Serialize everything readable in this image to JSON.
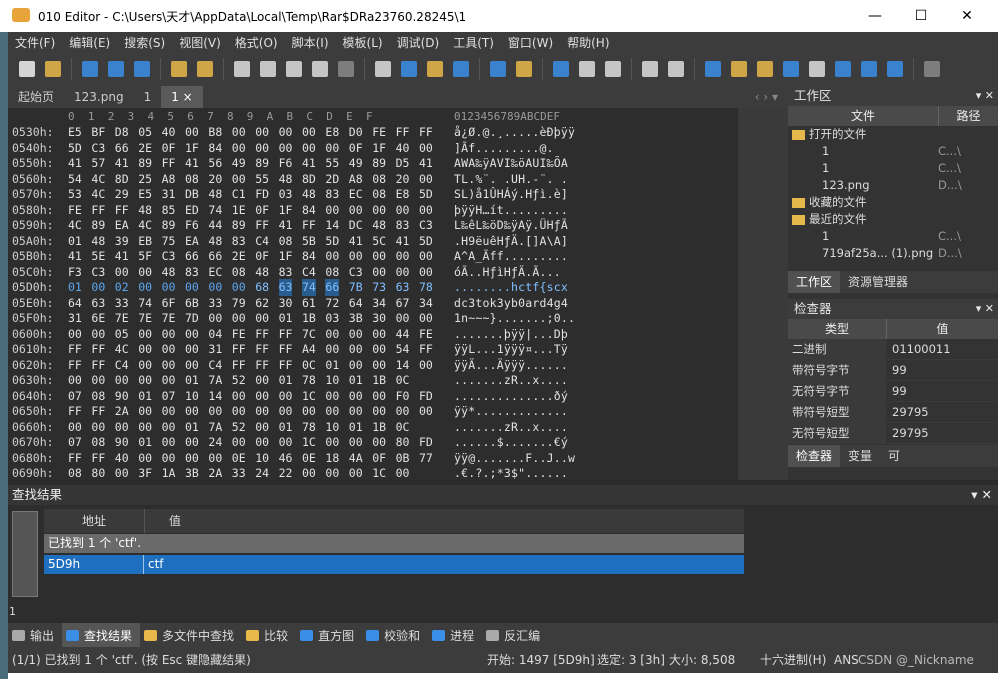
{
  "window": {
    "title": "010 Editor - C:\\Users\\天才\\AppData\\Local\\Temp\\Rar$DRa23760.28245\\1"
  },
  "menu": [
    "文件(F)",
    "编辑(E)",
    "搜索(S)",
    "视图(V)",
    "格式(O)",
    "脚本(I)",
    "模板(L)",
    "调试(D)",
    "工具(T)",
    "窗口(W)",
    "帮助(H)"
  ],
  "tabs": [
    {
      "label": "起始页"
    },
    {
      "label": "123.png"
    },
    {
      "label": "1"
    },
    {
      "label": "1 ×",
      "active": true
    }
  ],
  "hex": {
    "column_header": "0  1  2  3  4  5  6  7  8  9  A  B  C  D  E  F",
    "ascii_header": "0123456789ABCDEF",
    "rows": [
      {
        "addr": "0530h:",
        "bytes": [
          "E5",
          "BF",
          "D8",
          "05",
          "40",
          "00",
          "B8",
          "00",
          "00",
          "00",
          "00",
          "E8",
          "D0",
          "FE",
          "FF",
          "FF"
        ],
        "ascii": "å¿Ø.@.¸.....èÐþÿÿ"
      },
      {
        "addr": "0540h:",
        "bytes": [
          "5D",
          "C3",
          "66",
          "2E",
          "0F",
          "1F",
          "84",
          "00",
          "00",
          "00",
          "00",
          "00",
          "0F",
          "1F",
          "40",
          "00"
        ],
        "ascii": "]Ãf.........@."
      },
      {
        "addr": "0550h:",
        "bytes": [
          "41",
          "57",
          "41",
          "89",
          "FF",
          "41",
          "56",
          "49",
          "89",
          "F6",
          "41",
          "55",
          "49",
          "89",
          "D5",
          "41"
        ],
        "ascii": "AWA‰ÿAVI‰öAUI‰ÕA"
      },
      {
        "addr": "0560h:",
        "bytes": [
          "54",
          "4C",
          "8D",
          "25",
          "A8",
          "08",
          "20",
          "00",
          "55",
          "48",
          "8D",
          "2D",
          "A8",
          "08",
          "20",
          "00"
        ],
        "ascii": "TL.%¨. .UH.-¨. ."
      },
      {
        "addr": "0570h:",
        "bytes": [
          "53",
          "4C",
          "29",
          "E5",
          "31",
          "DB",
          "48",
          "C1",
          "FD",
          "03",
          "48",
          "83",
          "EC",
          "08",
          "E8",
          "5D"
        ],
        "ascii": "SL)å1ÛHÁý.Hƒì.è]"
      },
      {
        "addr": "0580h:",
        "bytes": [
          "FE",
          "FF",
          "FF",
          "48",
          "85",
          "ED",
          "74",
          "1E",
          "0F",
          "1F",
          "84",
          "00",
          "00",
          "00",
          "00",
          "00"
        ],
        "ascii": "þÿÿH…ít........."
      },
      {
        "addr": "0590h:",
        "bytes": [
          "4C",
          "89",
          "EA",
          "4C",
          "89",
          "F6",
          "44",
          "89",
          "FF",
          "41",
          "FF",
          "14",
          "DC",
          "48",
          "83",
          "C3"
        ],
        "ascii": "L‰êL‰öD‰ÿAÿ.ÜHƒÃ"
      },
      {
        "addr": "05A0h:",
        "bytes": [
          "01",
          "48",
          "39",
          "EB",
          "75",
          "EA",
          "48",
          "83",
          "C4",
          "08",
          "5B",
          "5D",
          "41",
          "5C",
          "41",
          "5D"
        ],
        "ascii": ".H9ëuêHƒÄ.[]A\\A]"
      },
      {
        "addr": "05B0h:",
        "bytes": [
          "41",
          "5E",
          "41",
          "5F",
          "C3",
          "66",
          "66",
          "2E",
          "0F",
          "1F",
          "84",
          "00",
          "00",
          "00",
          "00",
          "00"
        ],
        "ascii": "A^A_Ãff........."
      },
      {
        "addr": "05C0h:",
        "bytes": [
          "F3",
          "C3",
          "00",
          "00",
          "48",
          "83",
          "EC",
          "08",
          "48",
          "83",
          "C4",
          "08",
          "C3",
          "00",
          "00",
          "00"
        ],
        "ascii": "óÃ..HƒìHƒÄ.Ã..."
      },
      {
        "addr": "05D0h:",
        "bytes": [
          "01",
          "00",
          "02",
          "00",
          "00",
          "00",
          "00",
          "00",
          "68",
          "63",
          "74",
          "66",
          "7B",
          "73",
          "63",
          "78"
        ],
        "ascii": "........hctf{scx",
        "sel": true
      },
      {
        "addr": "05E0h:",
        "bytes": [
          "64",
          "63",
          "33",
          "74",
          "6F",
          "6B",
          "33",
          "79",
          "62",
          "30",
          "61",
          "72",
          "64",
          "34",
          "67",
          "34"
        ],
        "ascii": "dc3tok3yb0ard4g4"
      },
      {
        "addr": "05F0h:",
        "bytes": [
          "31",
          "6E",
          "7E",
          "7E",
          "7E",
          "7D",
          "00",
          "00",
          "00",
          "01",
          "1B",
          "03",
          "3B",
          "30",
          "00",
          "00"
        ],
        "ascii": "1n~~~}.......;0.."
      },
      {
        "addr": "0600h:",
        "bytes": [
          "00",
          "00",
          "05",
          "00",
          "00",
          "00",
          "04",
          "FE",
          "FF",
          "FF",
          "7C",
          "00",
          "00",
          "00",
          "44",
          "FE"
        ],
        "ascii": ".......þÿÿ|...Dþ"
      },
      {
        "addr": "0610h:",
        "bytes": [
          "FF",
          "FF",
          "4C",
          "00",
          "00",
          "00",
          "31",
          "FF",
          "FF",
          "FF",
          "A4",
          "00",
          "00",
          "00",
          "54",
          "FF"
        ],
        "ascii": "ÿÿL...1ÿÿÿ¤...Tÿ"
      },
      {
        "addr": "0620h:",
        "bytes": [
          "FF",
          "FF",
          "C4",
          "00",
          "00",
          "00",
          "C4",
          "FF",
          "FF",
          "FF",
          "0C",
          "01",
          "00",
          "00",
          "14",
          "00"
        ],
        "ascii": "ÿÿÄ...Äÿÿÿ......"
      },
      {
        "addr": "0630h:",
        "bytes": [
          "00",
          "00",
          "00",
          "00",
          "00",
          "01",
          "7A",
          "52",
          "00",
          "01",
          "78",
          "10",
          "01",
          "1B",
          "0C"
        ],
        "ascii": ".......zR..x...."
      },
      {
        "addr": "0640h:",
        "bytes": [
          "07",
          "08",
          "90",
          "01",
          "07",
          "10",
          "14",
          "00",
          "00",
          "00",
          "1C",
          "00",
          "00",
          "00",
          "F0",
          "FD"
        ],
        "ascii": "..............ðý"
      },
      {
        "addr": "0650h:",
        "bytes": [
          "FF",
          "FF",
          "2A",
          "00",
          "00",
          "00",
          "00",
          "00",
          "00",
          "00",
          "00",
          "00",
          "00",
          "00",
          "00",
          "00"
        ],
        "ascii": "ÿÿ*............."
      },
      {
        "addr": "0660h:",
        "bytes": [
          "00",
          "00",
          "00",
          "00",
          "00",
          "01",
          "7A",
          "52",
          "00",
          "01",
          "78",
          "10",
          "01",
          "1B",
          "0C"
        ],
        "ascii": ".......zR..x...."
      },
      {
        "addr": "0670h:",
        "bytes": [
          "07",
          "08",
          "90",
          "01",
          "00",
          "00",
          "24",
          "00",
          "00",
          "00",
          "1C",
          "00",
          "00",
          "00",
          "80",
          "FD"
        ],
        "ascii": "......$.......€ý"
      },
      {
        "addr": "0680h:",
        "bytes": [
          "FF",
          "FF",
          "40",
          "00",
          "00",
          "00",
          "00",
          "0E",
          "10",
          "46",
          "0E",
          "18",
          "4A",
          "0F",
          "0B",
          "77"
        ],
        "ascii": "ÿÿ@.......F..J..w"
      },
      {
        "addr": "0690h:",
        "bytes": [
          "08",
          "80",
          "00",
          "3F",
          "1A",
          "3B",
          "2A",
          "33",
          "24",
          "22",
          "00",
          "00",
          "00",
          "1C",
          "00"
        ],
        "ascii": ".€.?.;*3$\"......"
      },
      {
        "addr": "06A0h:",
        "bytes": [
          "00",
          "00",
          "44",
          "00",
          "00",
          "00",
          "85",
          "FE",
          "FF",
          "FF",
          "15",
          "00",
          "00",
          "00",
          "00",
          "41"
        ],
        "ascii": "..D....þÿÿ.....A"
      }
    ]
  },
  "workspace": {
    "title": "工作区",
    "col_file": "文件",
    "col_path": "路径",
    "items": [
      {
        "label": "打开的文件",
        "folder": true,
        "path": ""
      },
      {
        "label": "1",
        "path": "C...\\"
      },
      {
        "label": "1",
        "path": "C...\\"
      },
      {
        "label": "123.png",
        "path": "D...\\"
      },
      {
        "label": "收藏的文件",
        "folder": true,
        "path": ""
      },
      {
        "label": "最近的文件",
        "folder": true,
        "path": ""
      },
      {
        "label": "1",
        "path": "C...\\"
      },
      {
        "label": "719af25a... (1).png",
        "path": "D...\\"
      }
    ],
    "tab_workspace": "工作区",
    "tab_explorer": "资源管理器"
  },
  "inspector": {
    "title": "检查器",
    "col_type": "类型",
    "col_value": "值",
    "rows": [
      {
        "type": "二进制",
        "value": "01100011"
      },
      {
        "type": "带符号字节",
        "value": "99"
      },
      {
        "type": "无符号字节",
        "value": "99"
      },
      {
        "type": "带符号短型",
        "value": "29795"
      },
      {
        "type": "无符号短型",
        "value": "29795"
      }
    ],
    "tab_inspector": "检查器",
    "tab_vars": "变量",
    "tab_more": "可"
  },
  "find": {
    "title": "查找结果",
    "col_addr": "地址",
    "col_value": "值",
    "summary": "已找到 1 个 'ctf'.",
    "result_addr": "5D9h",
    "result_value": "ctf",
    "counter": "1"
  },
  "bottom_tabs": [
    "输出",
    "查找结果",
    "多文件中查找",
    "比较",
    "直方图",
    "校验和",
    "进程",
    "反汇编"
  ],
  "status": {
    "message": "(1/1) 已找到 1 个 'ctf'. (按 Esc 键隐藏结果)",
    "start": "开始: 1497 [5D9h]",
    "selected": "选定: 3 [3h]",
    "size": "大小: 8,508",
    "mode": "十六进制(H)",
    "encoding": "ANS",
    "watermark": "CSDN @_Nickname"
  },
  "colors": {
    "accent": "#2a5d8f",
    "selection_row": "#1e6fbf",
    "toolbar_blue": "#3a8ee6"
  }
}
